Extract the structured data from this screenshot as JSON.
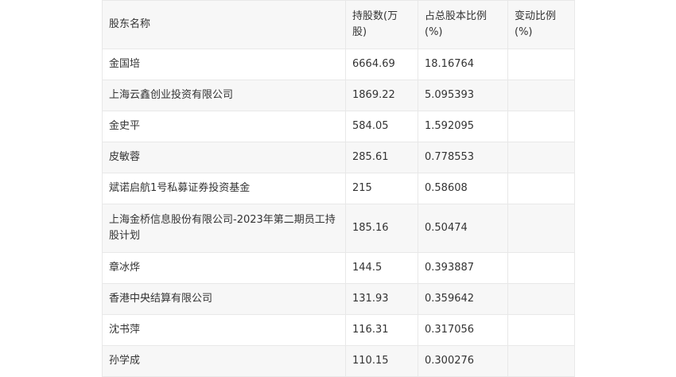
{
  "table": {
    "headers": [
      "股东名称",
      "持股数(万股)",
      "占总股本比例(%)",
      "变动比例(%)"
    ],
    "rows": [
      {
        "name": "金国培",
        "shares": "6664.69",
        "ratio": "18.16764",
        "change": ""
      },
      {
        "name": "上海云鑫创业投资有限公司",
        "shares": "1869.22",
        "ratio": "5.095393",
        "change": ""
      },
      {
        "name": "金史平",
        "shares": "584.05",
        "ratio": "1.592095",
        "change": ""
      },
      {
        "name": "皮敏蓉",
        "shares": "285.61",
        "ratio": "0.778553",
        "change": ""
      },
      {
        "name": "斌诺启航1号私募证券投资基金",
        "shares": "215",
        "ratio": "0.58608",
        "change": ""
      },
      {
        "name": "上海金桥信息股份有限公司-2023年第二期员工持股计划",
        "shares": "185.16",
        "ratio": "0.50474",
        "change": ""
      },
      {
        "name": "章冰烨",
        "shares": "144.5",
        "ratio": "0.393887",
        "change": ""
      },
      {
        "name": "香港中央结算有限公司",
        "shares": "131.93",
        "ratio": "0.359642",
        "change": ""
      },
      {
        "name": "沈书萍",
        "shares": "116.31",
        "ratio": "0.317056",
        "change": ""
      },
      {
        "name": "孙学成",
        "shares": "110.15",
        "ratio": "0.300276",
        "change": ""
      }
    ]
  }
}
